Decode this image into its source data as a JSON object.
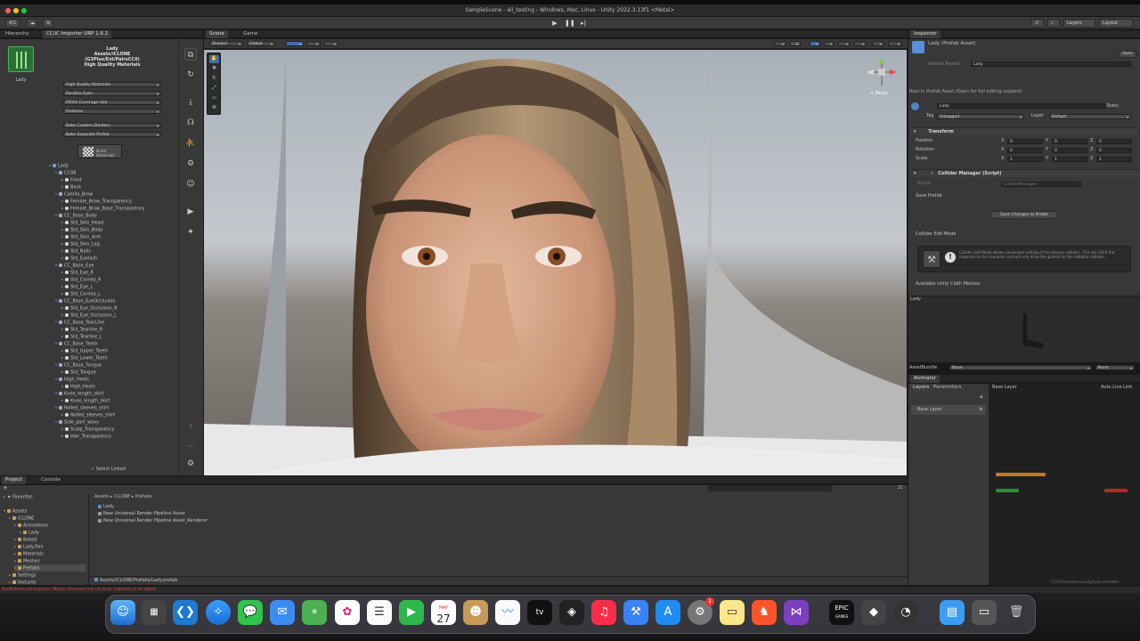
{
  "window": {
    "title": "SampleScene - all_testing - Windows, Mac, Linux - Unity 2022.3.13f1 <Metal>"
  },
  "toolbar": {
    "account": "A/1",
    "layers": "Layers",
    "layout": "Layout"
  },
  "hierarchy": {
    "tab_hierarchy": "Hierarchy",
    "tab_importer": "CC/iC Importer URP 1.6.2"
  },
  "importer": {
    "character_name": "Lady",
    "asset_path": "Assets/iCLONE",
    "generation": "(G3Plus/Ext/PairsCC4)",
    "quality_title": "High Quality Materials",
    "avatar_label": "Lady",
    "dropdowns": [
      "High Quality Materials",
      "Parallax Eyes",
      "MSAA Coverage Hair",
      "Features"
    ],
    "dropdowns2": [
      "Bake Custom Shaders",
      "Bake Separate Prefab"
    ],
    "build_button": "Build Materials",
    "select_linked": "Select Linked"
  },
  "tree": [
    {
      "label": "Lady",
      "depth": 0,
      "kind": "root"
    },
    {
      "label": "CC08",
      "depth": 1,
      "kind": "group"
    },
    {
      "label": "Front",
      "depth": 2,
      "kind": "mat"
    },
    {
      "label": "Back",
      "depth": 2,
      "kind": "mat"
    },
    {
      "label": "Camila_Brow",
      "depth": 1,
      "kind": "group"
    },
    {
      "label": "Female_Brow_Transparency",
      "depth": 2,
      "kind": "mat"
    },
    {
      "label": "Female_Brow_Base_Transparency",
      "depth": 2,
      "kind": "mat"
    },
    {
      "label": "CC_Base_Body",
      "depth": 1,
      "kind": "group"
    },
    {
      "label": "Std_Skin_Head",
      "depth": 2,
      "kind": "mat"
    },
    {
      "label": "Std_Skin_Body",
      "depth": 2,
      "kind": "mat"
    },
    {
      "label": "Std_Skin_Arm",
      "depth": 2,
      "kind": "mat"
    },
    {
      "label": "Std_Skin_Leg",
      "depth": 2,
      "kind": "mat"
    },
    {
      "label": "Std_Nails",
      "depth": 2,
      "kind": "mat"
    },
    {
      "label": "Std_Eyelash",
      "depth": 2,
      "kind": "mat"
    },
    {
      "label": "CC_Base_Eye",
      "depth": 1,
      "kind": "group"
    },
    {
      "label": "Std_Eye_R",
      "depth": 2,
      "kind": "mat"
    },
    {
      "label": "Std_Cornea_R",
      "depth": 2,
      "kind": "mat"
    },
    {
      "label": "Std_Eye_L",
      "depth": 2,
      "kind": "mat"
    },
    {
      "label": "Std_Cornea_L",
      "depth": 2,
      "kind": "mat"
    },
    {
      "label": "CC_Base_EyeOcclusion",
      "depth": 1,
      "kind": "group"
    },
    {
      "label": "Std_Eye_Occlusion_R",
      "depth": 2,
      "kind": "mat"
    },
    {
      "label": "Std_Eye_Occlusion_L",
      "depth": 2,
      "kind": "mat"
    },
    {
      "label": "CC_Base_TearLine",
      "depth": 1,
      "kind": "group"
    },
    {
      "label": "Std_Tearline_R",
      "depth": 2,
      "kind": "mat"
    },
    {
      "label": "Std_Tearline_L",
      "depth": 2,
      "kind": "mat"
    },
    {
      "label": "CC_Base_Teeth",
      "depth": 1,
      "kind": "group"
    },
    {
      "label": "Std_Upper_Teeth",
      "depth": 2,
      "kind": "mat"
    },
    {
      "label": "Std_Lower_Teeth",
      "depth": 2,
      "kind": "mat"
    },
    {
      "label": "CC_Base_Tongue",
      "depth": 1,
      "kind": "group"
    },
    {
      "label": "Std_Tongue",
      "depth": 2,
      "kind": "mat"
    },
    {
      "label": "High_Heels",
      "depth": 1,
      "kind": "group"
    },
    {
      "label": "High_Heels",
      "depth": 2,
      "kind": "mat"
    },
    {
      "label": "Knee_length_skirt",
      "depth": 1,
      "kind": "group"
    },
    {
      "label": "Knee_length_skirt",
      "depth": 2,
      "kind": "mat"
    },
    {
      "label": "Rolled_sleeves_shirt",
      "depth": 1,
      "kind": "group"
    },
    {
      "label": "Rolled_sleeves_shirt",
      "depth": 2,
      "kind": "mat"
    },
    {
      "label": "Side_part_wavy",
      "depth": 1,
      "kind": "group"
    },
    {
      "label": "Scalp_Transparency",
      "depth": 2,
      "kind": "mat"
    },
    {
      "label": "Hair_Transparency",
      "depth": 2,
      "kind": "mat"
    }
  ],
  "scene": {
    "tab_scene": "Scene",
    "tab_game": "Game",
    "shading": "Shaded",
    "gizmo_mode": "Global",
    "persp_label": "< Persp"
  },
  "inspector": {
    "tab": "Inspector",
    "prefab_title": "Lady (Prefab Asset)",
    "open_button": "Open",
    "variant_parent_label": "Variant Parent",
    "variant_parent_value": "Lady",
    "root_note": "Root in Prefab Asset (Open for full editing support)",
    "object_name": "Lady",
    "static_label": "Static",
    "tag_label": "Tag",
    "tag_value": "Untagged",
    "layer_label": "Layer",
    "layer_value": "Default",
    "transform_title": "Transform",
    "position_label": "Position",
    "rotation_label": "Rotation",
    "scale_label": "Scale",
    "position": [
      "0",
      "0",
      "0"
    ],
    "rotation": [
      "0",
      "0",
      "0"
    ],
    "scale": [
      "1",
      "1",
      "1"
    ],
    "axis_x": "X",
    "axis_y": "Y",
    "axis_z": "Z",
    "collider_title": "Collider Manager (Script)",
    "script_label": "Script",
    "script_value": "ColliderManager",
    "save_prefab_label": "Save Prefab",
    "save_button": "Save Changes to Prefab",
    "edit_mode_label": "Collider Edit Mode",
    "edit_mode_note": "Collider Edit Mode allows convenient editing of the physics colliders. This will LOCK the inspector to the character and will only draw the gizmos for the editable colliders.",
    "cloth_label": "Available Unity Cloth Meshes",
    "preview_label": "Lady",
    "asset_bundle_label": "AssetBundle",
    "asset_bundle_value": "None",
    "asset_variant_value": "None"
  },
  "animator": {
    "tab": "Animator",
    "layers_tab": "Layers",
    "parameters_tab": "Parameters",
    "base_layer_crumb": "Base Layer",
    "auto_live": "Auto Live Link",
    "base_layer_item": "Base Layer",
    "status_path": "CC/iC/Animations/Lady/Lady.controller"
  },
  "project": {
    "tab_project": "Project",
    "tab_console": "Console",
    "favorites": "Favorites",
    "assets_root": "Assets",
    "folders": [
      {
        "label": "iCLONE",
        "depth": 1
      },
      {
        "label": "Animations",
        "depth": 2
      },
      {
        "label": "Lady",
        "depth": 3
      },
      {
        "label": "Baked",
        "depth": 2
      },
      {
        "label": "Lady.fbm",
        "depth": 2
      },
      {
        "label": "Materials",
        "depth": 2
      },
      {
        "label": "Meshes",
        "depth": 2
      },
      {
        "label": "Prefabs",
        "depth": 2
      },
      {
        "label": "Settings",
        "depth": 1
      },
      {
        "label": "textures",
        "depth": 1
      }
    ],
    "breadcrumb": [
      "Assets",
      "iCLONE",
      "Prefabs"
    ],
    "files": [
      "Lady",
      "New Universal Render Pipeline Asset",
      "New Universal Render Pipeline Asset_Renderer"
    ],
    "selected_path": "Assets/iCLONE/Prefabs/Lady.prefab",
    "item_count": "21"
  },
  "status": {
    "error": "NullReferenceException: Object reference not set to an instance of an object"
  },
  "dock": {
    "calendar_month": "MAY",
    "calendar_day": "27",
    "appletv": "tv",
    "epic": "EPIC",
    "epic_sub": "GAMES",
    "settings_badge": "1"
  }
}
